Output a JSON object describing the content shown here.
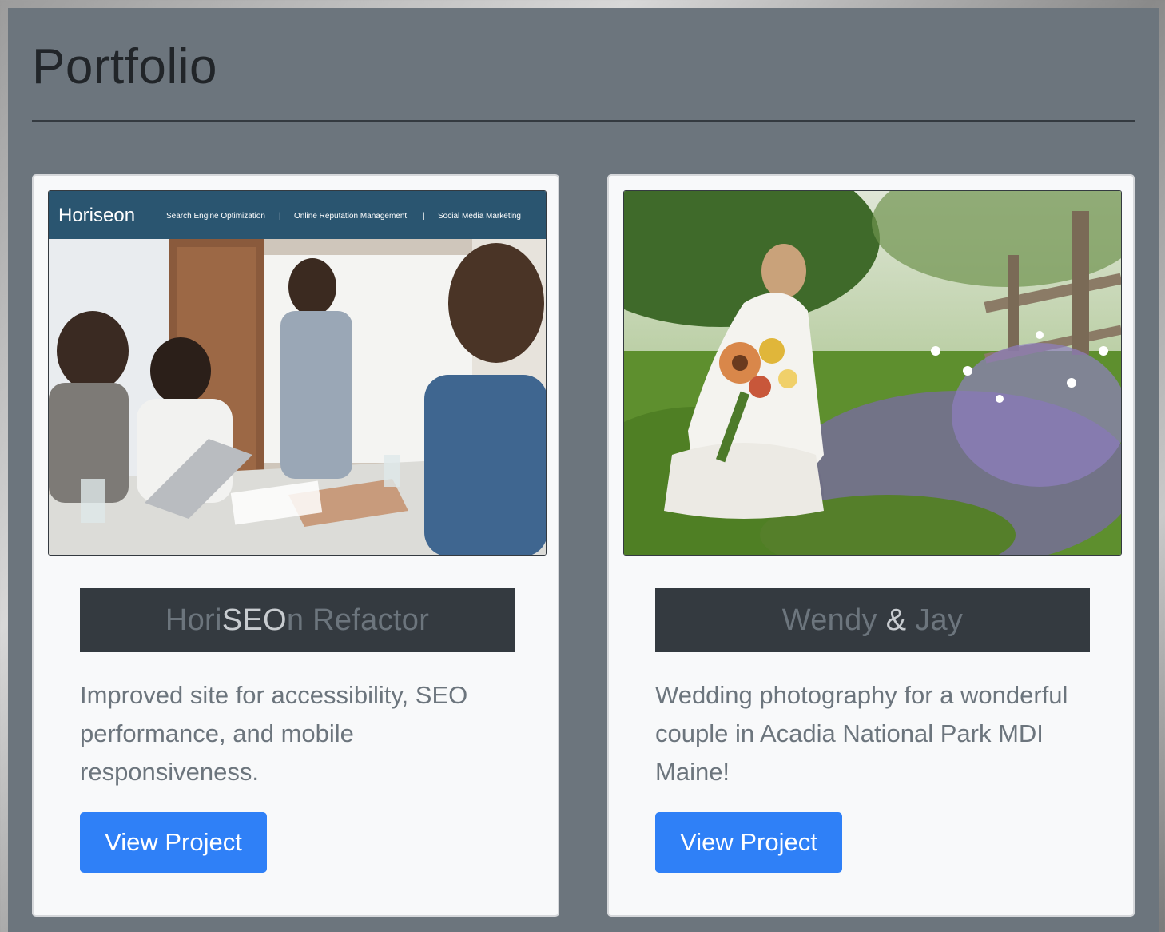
{
  "page": {
    "title": "Portfolio"
  },
  "projects": [
    {
      "title_parts": [
        "Hori",
        "SEO",
        "n Refactor"
      ],
      "description": "Improved site for accessibility, SEO performance, and mobile responsiveness.",
      "button_label": "View Project",
      "image": {
        "header_brand": "Horiseon",
        "header_nav": [
          "Search Engine Optimization",
          "Online Reputation Management",
          "Social Media Marketing"
        ]
      }
    },
    {
      "title_parts": [
        "Wendy ",
        "&",
        " Jay"
      ],
      "description": "Wedding photography for a wonderful couple in Acadia National Park MDI Maine!",
      "button_label": "View Project"
    }
  ],
  "colors": {
    "section_bg": "#6c757d",
    "card_bg": "#f8f9fa",
    "title_bar": "#343a40",
    "button": "#2f80f7",
    "muted_text": "#6c757d"
  }
}
